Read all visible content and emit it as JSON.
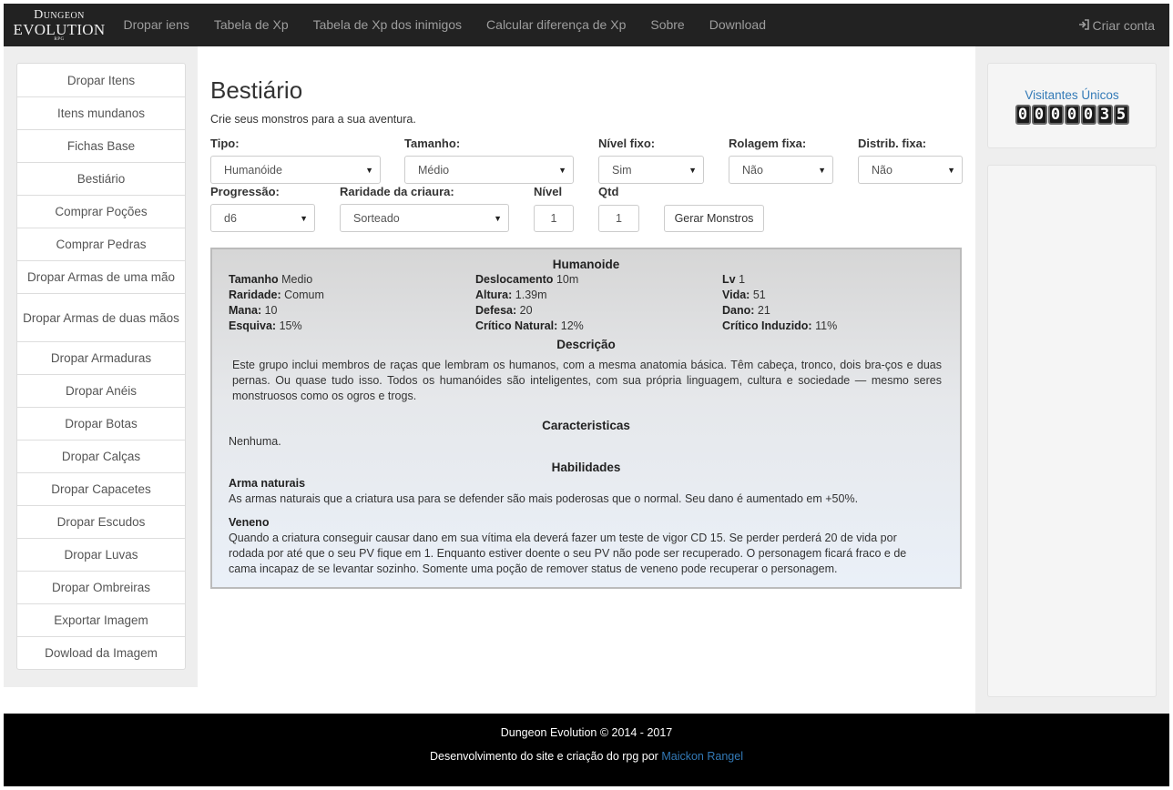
{
  "nav": {
    "logo": {
      "line1": "Dungeon",
      "line2": "EVOLUTION",
      "line3": "RPG"
    },
    "links": [
      "Dropar iens",
      "Tabela de Xp",
      "Tabela de Xp dos inimigos",
      "Calcular diferença de Xp",
      "Sobre",
      "Download"
    ],
    "signup": "Criar conta",
    "signup_icon": "login-icon"
  },
  "sidebar": {
    "items": [
      "Dropar Itens",
      "Itens mundanos",
      "Fichas Base",
      "Bestiário",
      "Comprar Poções",
      "Comprar Pedras",
      "Dropar Armas de uma mão",
      "Dropar Armas de duas mãos",
      "Dropar Armaduras",
      "Dropar Anéis",
      "Dropar Botas",
      "Dropar Calças",
      "Dropar Capacetes",
      "Dropar Escudos",
      "Dropar Luvas",
      "Dropar Ombreiras",
      "Exportar Imagem",
      "Dowload da Imagem"
    ]
  },
  "main": {
    "title": "Bestiário",
    "subtitle": "Crie seus monstros para a sua aventura.",
    "form": {
      "tipo": {
        "label": "Tipo:",
        "value": "Humanóide"
      },
      "tamanho": {
        "label": "Tamanho:",
        "value": "Médio"
      },
      "nivel_fixo": {
        "label": "Nível fixo:",
        "value": "Sim"
      },
      "rolagem_fixa": {
        "label": "Rolagem fixa:",
        "value": "Não"
      },
      "distrib_fixa": {
        "label": "Distrib. fixa:",
        "value": "Não"
      },
      "progressao": {
        "label": "Progressão:",
        "value": "d6"
      },
      "raridade": {
        "label": "Raridade da criaura:",
        "value": "Sorteado"
      },
      "nivel": {
        "label": "Nível",
        "value": "1"
      },
      "qtd": {
        "label": "Qtd",
        "value": "1"
      },
      "gerar_button": "Gerar Monstros"
    }
  },
  "monster": {
    "name": "Humanoide",
    "stats": {
      "tamanho": {
        "label": "Tamanho",
        "value": "Medio"
      },
      "raridade": {
        "label": "Raridade:",
        "value": "Comum"
      },
      "mana": {
        "label": "Mana:",
        "value": "10"
      },
      "esquiva": {
        "label": "Esquiva:",
        "value": "15%"
      },
      "deslocamento": {
        "label": "Deslocamento",
        "value": "10m"
      },
      "altura": {
        "label": "Altura:",
        "value": "1.39m"
      },
      "defesa": {
        "label": "Defesa:",
        "value": "20"
      },
      "critico_natural": {
        "label": "Crítico Natural:",
        "value": "12%"
      },
      "lv": {
        "label": "Lv",
        "value": "1"
      },
      "vida": {
        "label": "Vida:",
        "value": "51"
      },
      "dano": {
        "label": "Dano:",
        "value": "21"
      },
      "critico_induzido": {
        "label": "Crítico Induzido:",
        "value": "11%"
      }
    },
    "descricao_title": "Descrição",
    "descricao": "Este grupo inclui membros de raças que lembram os humanos, com a mesma anatomia básica. Têm cabeça, tronco, dois bra-ços e duas pernas. Ou quase tudo isso. Todos os humanóides são inteligentes, com sua própria linguagem, cultura e sociedade — mesmo seres monstruosos como os ogros e trogs.",
    "caracteristicas_title": "Caracteristicas",
    "caracteristicas": "Nenhuma.",
    "habilidades_title": "Habilidades",
    "habilidades": [
      {
        "name": "Arma naturais",
        "text": "As armas naturais que a criatura usa para se defender são mais poderosas que o normal. Seu dano é aumentado em +50%."
      },
      {
        "name": "Veneno",
        "text": "Quando a criatura conseguir causar dano em sua vítima ela deverá fazer um teste de vigor CD 15. Se perder perderá 20 de vida por rodada por até que o seu PV fique em 1. Enquanto estiver doente o seu PV não pode ser recuperado. O personagem ficará fraco e de cama incapaz de se levantar sozinho. Somente uma poção de remover status de veneno pode recuperar o personagem."
      }
    ]
  },
  "right": {
    "visitors_label": "Visitantes Únicos",
    "visitors_digits": [
      "0",
      "0",
      "0",
      "0",
      "0",
      "3",
      "5"
    ]
  },
  "footer": {
    "line1": "Dungeon Evolution © 2014 - 2017",
    "line2": "Desenvolvimento do site e criação do rpg por",
    "author": "Maickon Rangel"
  }
}
